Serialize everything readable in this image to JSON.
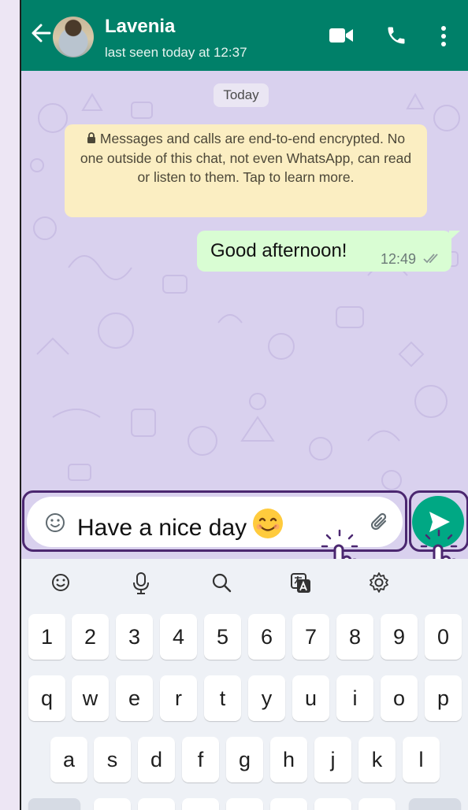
{
  "header": {
    "contact_name": "Lavenia",
    "status": "last seen today at 12:37",
    "icons": [
      "back-arrow-icon",
      "video-call-icon",
      "voice-call-icon",
      "more-options-icon"
    ],
    "bg_color": "#008069"
  },
  "chat": {
    "date_chip": "Today",
    "encryption_notice": "Messages and calls are end-to-end encrypted. No one outside of this chat, not even WhatsApp, can read or listen to them. Tap to learn more.",
    "messages": [
      {
        "text": "Good afternoon!",
        "time": "12:49",
        "status": "read"
      }
    ]
  },
  "composer": {
    "input_value": "Have a nice day",
    "input_emoji": "😊",
    "icons": [
      "emoji-icon",
      "attach-icon",
      "send-icon"
    ],
    "send_color": "#00a884"
  },
  "keyboard": {
    "toolbar_icons": [
      "emoji-icon",
      "mic-icon",
      "search-icon",
      "translate-icon",
      "settings-icon"
    ],
    "row1": [
      "1",
      "2",
      "3",
      "4",
      "5",
      "6",
      "7",
      "8",
      "9",
      "0"
    ],
    "row2": [
      "q",
      "w",
      "e",
      "r",
      "t",
      "y",
      "u",
      "i",
      "o",
      "p"
    ],
    "row3": [
      "a",
      "s",
      "d",
      "f",
      "g",
      "h",
      "j",
      "k",
      "l"
    ]
  },
  "highlight_color": "#4b2770"
}
